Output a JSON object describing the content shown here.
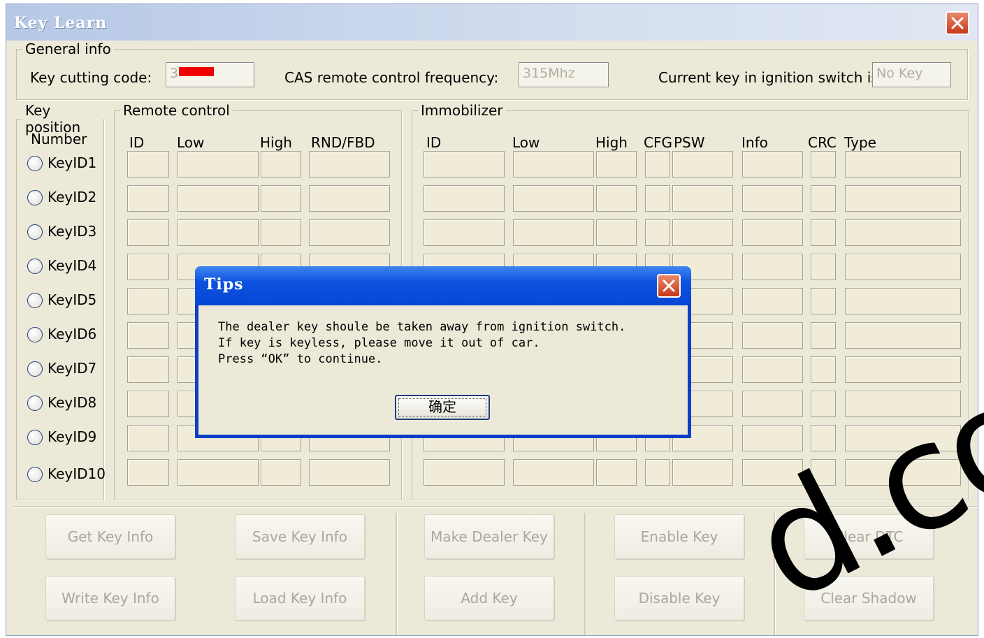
{
  "window": {
    "title": "Key Learn"
  },
  "general_info": {
    "legend": "General info",
    "key_cutting_code_label": "Key cutting code:",
    "key_cutting_code_value": "3",
    "cas_freq_label": "CAS remote control frequency:",
    "cas_freq_value": "315Mhz",
    "current_key_label": "Current key in ignition switch is:",
    "current_key_value": "No Key"
  },
  "key_position": {
    "legend": "Key position",
    "number_header": "Number",
    "keys": [
      "KeyID1",
      "KeyID2",
      "KeyID3",
      "KeyID4",
      "KeyID5",
      "KeyID6",
      "KeyID7",
      "KeyID8",
      "KeyID9",
      "KeyID10"
    ]
  },
  "remote_control": {
    "legend": "Remote control",
    "headers": [
      "ID",
      "Low",
      "High",
      "RND/FBD"
    ]
  },
  "immobilizer": {
    "legend": "Immobilizer",
    "headers": [
      "ID",
      "Low",
      "High",
      "CFG",
      "PSW",
      "Info",
      "CRC",
      "Type"
    ]
  },
  "buttons": {
    "get_key_info": "Get Key Info",
    "write_key_info": "Write Key Info",
    "save_key_info": "Save Key Info",
    "load_key_info": "Load Key Info",
    "make_dealer_key": "Make Dealer Key",
    "add_key": "Add Key",
    "enable_key": "Enable Key",
    "disable_key": "Disable Key",
    "clear_dtc": "Clear DTC",
    "clear_shadow": "Clear Shadow"
  },
  "watermark": {
    "text": "d.com"
  },
  "dialog": {
    "title": "Tips",
    "message": "The dealer key shoule be taken away from ignition switch.\nIf key is keyless, please move it out of car.\nPress “OK” to continue.",
    "ok_label": "确定"
  },
  "colors": {
    "dialog_frame": "#0a3fc6",
    "close_button": "#c8381a",
    "window_bg": "#ece9d8"
  }
}
